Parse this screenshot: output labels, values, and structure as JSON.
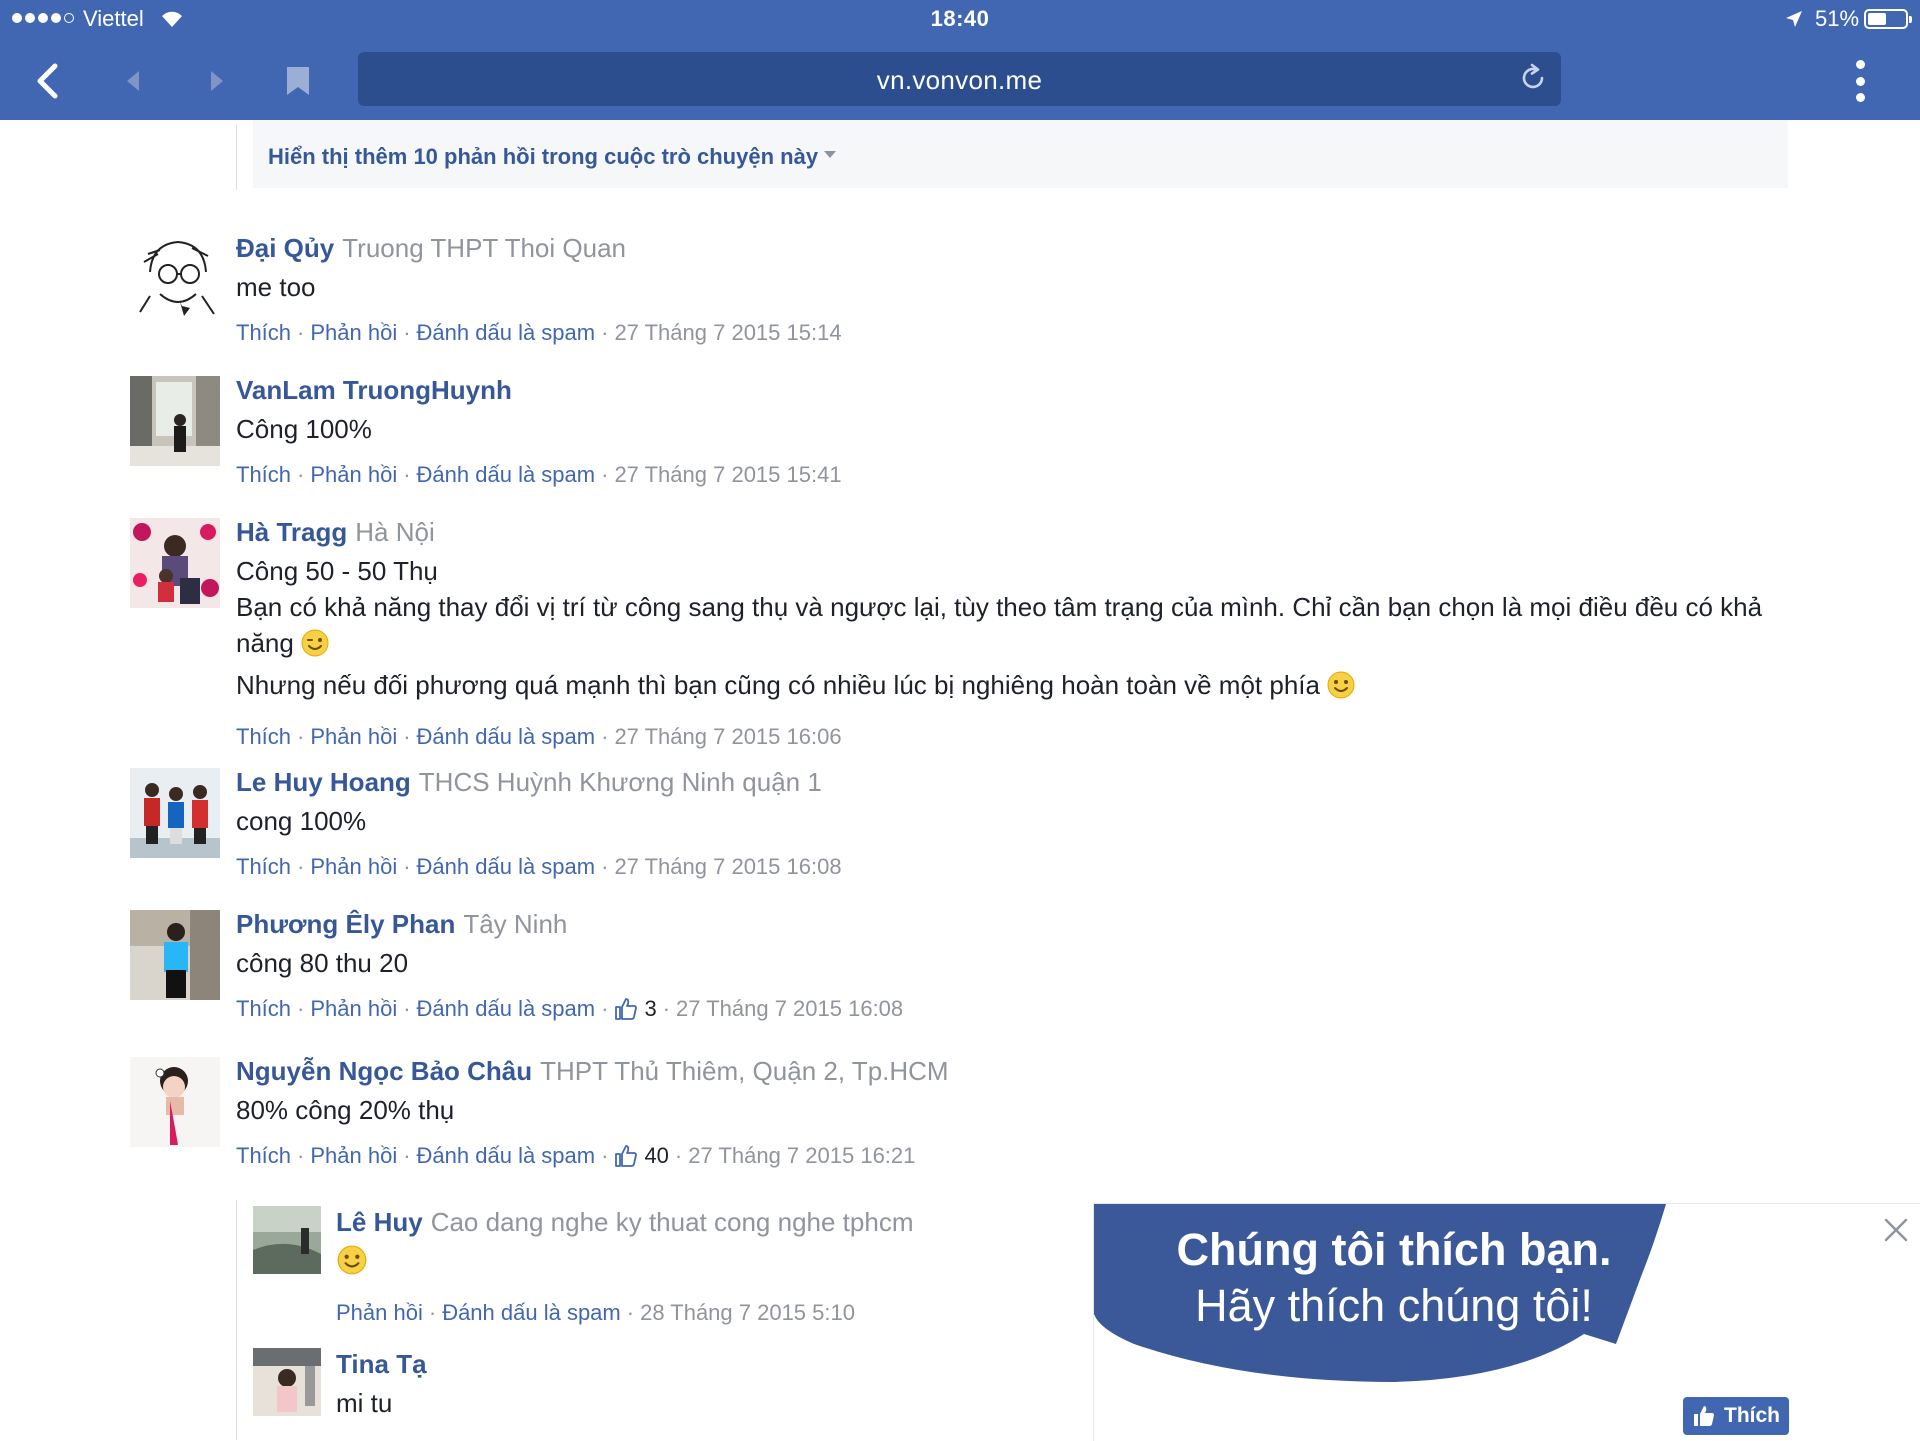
{
  "status_bar": {
    "carrier": "Viettel",
    "time": "18:40",
    "battery_percent": "51%",
    "battery_level": 0.51
  },
  "browser": {
    "url": "vn.vonvon.me"
  },
  "more_replies_link": "Hiển thị thêm 10 phản hồi trong cuộc trò chuyện này",
  "actions": {
    "like": "Thích",
    "reply": "Phản hồi",
    "mark_spam": "Đánh dấu là spam"
  },
  "comments": [
    {
      "author": "Đại Qủy",
      "affiliation": "Truong THPT Thoi Quan",
      "lines": [
        "me too"
      ],
      "likes": null,
      "timestamp": "27 Tháng 7 2015 15:14"
    },
    {
      "author": "VanLam TruongHuynh",
      "affiliation": "",
      "lines": [
        "Công 100%"
      ],
      "likes": null,
      "timestamp": "27 Tháng 7 2015 15:41"
    },
    {
      "author": "Hà Tragg",
      "affiliation": "Hà Nội",
      "lines": [
        "Công 50 - 50 Thụ",
        "Bạn có khả năng thay đổi vị trí từ công sang thụ và ngược lại, tùy theo tâm trạng của mình. Chỉ cần bạn chọn là mọi điều đều có khả",
        "năng",
        "Nhưng nếu đối phương quá mạnh thì bạn cũng có nhiều lúc bị nghiêng hoàn toàn về một phía"
      ],
      "likes": null,
      "timestamp": "27 Tháng 7 2015 16:06"
    },
    {
      "author": "Le Huy Hoang",
      "affiliation": "THCS Huỳnh Khương Ninh quận 1",
      "lines": [
        "cong 100%"
      ],
      "likes": null,
      "timestamp": "27 Tháng 7 2015 16:08"
    },
    {
      "author": "Phương Êly Phan",
      "affiliation": "Tây Ninh",
      "lines": [
        "công 80 thu 20"
      ],
      "likes": "3",
      "timestamp": "27 Tháng 7 2015 16:08"
    },
    {
      "author": "Nguyễn Ngọc Bảo Châu",
      "affiliation": "THPT Thủ Thiêm, Quận 2, Tp.HCM",
      "lines": [
        "80% công 20% thụ"
      ],
      "likes": "40",
      "timestamp": "27 Tháng 7 2015 16:21"
    }
  ],
  "replies": [
    {
      "author": "Lê Huy",
      "affiliation": "Cao dang nghe ky thuat cong nghe tphcm",
      "timestamp": "28 Tháng 7 2015 5:10"
    },
    {
      "author": "Tina Tạ",
      "affiliation": "",
      "lines": [
        "mi tu"
      ]
    }
  ],
  "like_banner": {
    "line1": "Chúng tôi thích bạn.",
    "line2": "Hãy thích chúng tôi!",
    "button": "Thích",
    "accent": "#3b5998"
  },
  "colors": {
    "chrome": "#4267b2",
    "link": "#365899",
    "meta": "#90949c"
  }
}
